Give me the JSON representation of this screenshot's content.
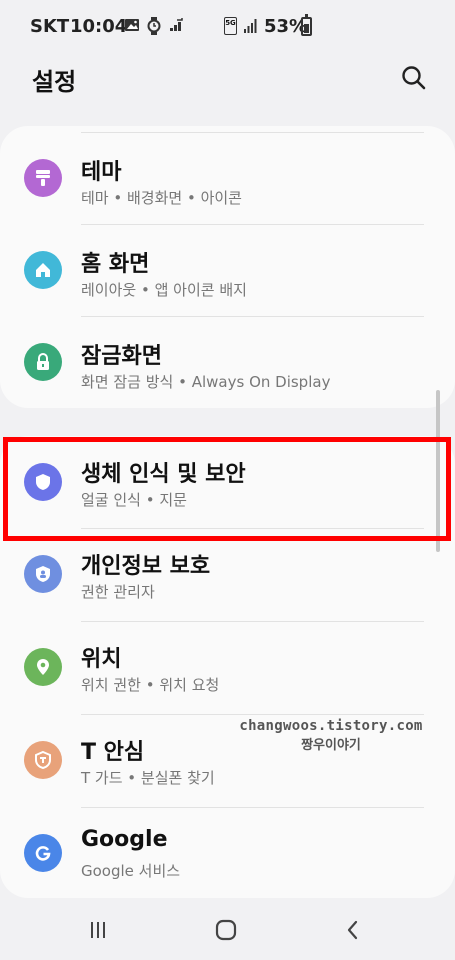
{
  "status_bar": {
    "carrier": "SKT",
    "time": "10:04",
    "network": "5G",
    "battery": "53%"
  },
  "header": {
    "title": "설정"
  },
  "top_items": [
    {
      "title": "테마",
      "subtitle": "테마 • 배경화면 • 아이콘",
      "icon": "theme-brush-icon",
      "color": "#b368d3"
    },
    {
      "title": "홈 화면",
      "subtitle": "레이아웃 • 앱 아이콘 배지",
      "icon": "home-icon",
      "color": "#41b8d8"
    },
    {
      "title": "잠금화면",
      "subtitle": "화면 잠금 방식 • Always On Display",
      "icon": "lock-icon",
      "color": "#39a97a"
    }
  ],
  "bottom_items": [
    {
      "title": "생체 인식 및 보안",
      "subtitle": "얼굴 인식 • 지문",
      "icon": "shield-icon",
      "color": "#6b74e8"
    },
    {
      "title": "개인정보 보호",
      "subtitle": "권한 관리자",
      "icon": "privacy-shield-icon",
      "color": "#6f8fe0"
    },
    {
      "title": "위치",
      "subtitle": "위치 권한 • 위치 요청",
      "icon": "location-pin-icon",
      "color": "#6cb55b"
    },
    {
      "title": "T 안심",
      "subtitle": "T 가드 • 분실폰 찾기",
      "icon": "t-guard-icon",
      "color": "#e8a27a"
    },
    {
      "title": "Google",
      "subtitle": "Google 서비스",
      "icon": "google-icon",
      "color": "#4a86e8"
    }
  ],
  "watermark": {
    "line1": "changwoos.tistory.com",
    "line2": "짱우이야기"
  },
  "colors": {
    "highlight": "#ff0000",
    "background": "#f1f1f3",
    "card": "#fafafa"
  }
}
